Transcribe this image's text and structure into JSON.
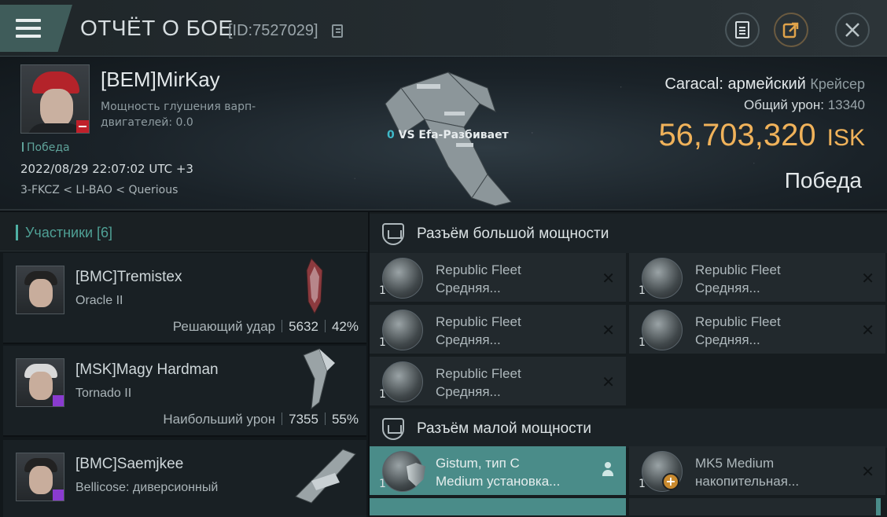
{
  "header": {
    "title": "ОТЧЁТ О БОЕ",
    "id_label": "[ID:7527029]",
    "menu_icon": "hamburger-menu-icon",
    "notes_icon": "notes-icon",
    "share_icon": "share-icon",
    "close_icon": "close-icon"
  },
  "victim": {
    "name": "[BEM]MirKay",
    "warp_label": "Мощность глушения варп-двигателей: 0.0",
    "result_small": "Победа",
    "datetime": "2022/08/29 22:07:02 UTC +3",
    "location": "3-FKCZ < LI-BAO < Querious",
    "vs_count": "0",
    "vs_text": "VS Efa-Разбивает",
    "ship_name": "Caracal: армейский",
    "ship_class": "Крейсер",
    "total_damage_label": "Общий урон:",
    "total_damage_value": "13340",
    "isk_value": "56,703,320",
    "isk_unit": "ISK",
    "result_big": "Победа"
  },
  "participants": {
    "header": "Участники [6]",
    "rows": [
      {
        "name": "[BMC]Tremistex",
        "ship": "Oracle II",
        "role": "Решающий удар",
        "damage": "5632",
        "percent": "42%"
      },
      {
        "name": "[MSK]Magy Hardman",
        "ship": "Tornado II",
        "role": "Наибольший урон",
        "damage": "7355",
        "percent": "55%"
      },
      {
        "name": "[BMC]Saemjkee",
        "ship": "Bellicose: диверсионный",
        "role": "",
        "damage": "",
        "percent": ""
      }
    ]
  },
  "modules": {
    "high_slot_label": "Разъём большой мощности",
    "low_slot_label": "Разъём малой мощности",
    "high": [
      {
        "qty": "1",
        "line1": "Republic Fleet",
        "line2": "Средняя..."
      },
      {
        "qty": "1",
        "line1": "Republic Fleet",
        "line2": "Средняя..."
      },
      {
        "qty": "1",
        "line1": "Republic Fleet",
        "line2": "Средняя..."
      },
      {
        "qty": "1",
        "line1": "Republic Fleet",
        "line2": "Средняя..."
      },
      {
        "qty": "1",
        "line1": "Republic Fleet",
        "line2": "Средняя..."
      }
    ],
    "low": [
      {
        "qty": "1",
        "line1": "Gistum, тип C",
        "line2": "Medium установка..."
      },
      {
        "qty": "1",
        "line1": "MK5 Medium",
        "line2": "накопительная..."
      }
    ],
    "close_glyph": "✕"
  }
}
